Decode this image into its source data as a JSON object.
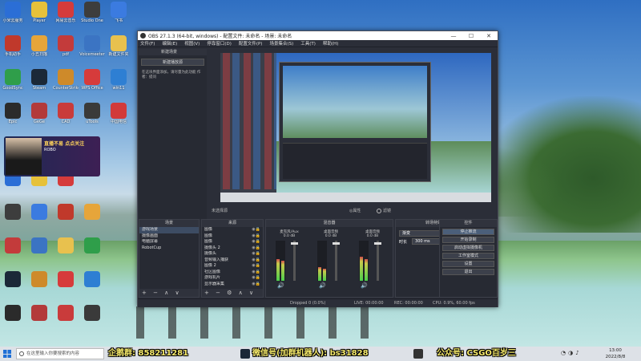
{
  "window": {
    "title": "OBS 27.1.3 (64-bit, windows) - 配置文件: 未命名 - 场景: 未命名",
    "controls": [
      "—",
      "☐",
      "✕"
    ]
  },
  "menu": [
    "文件(F)",
    "编辑(E)",
    "视图(V)",
    "停靠窗口(D)",
    "配置文件(P)",
    "场景集合(S)",
    "工具(T)",
    "帮助(H)"
  ],
  "left_panel": {
    "header": "新建场景",
    "button": "新建播放源",
    "note": "在这块界面添加，请尽量为此功能\n作者：提问"
  },
  "scene_bar": {
    "left": "未选择源",
    "mid": "◎属性",
    "right": "滤镜"
  },
  "docks": {
    "scenes": {
      "title": "场景",
      "items": [
        "游戏场景",
        "摄像画面",
        "电脑屏幕",
        "RobotCup"
      ],
      "selected": 0
    },
    "sources": {
      "title": "来源",
      "items": [
        "图像",
        "图像",
        "图像",
        "摄像头 2",
        "摄像头",
        "音频输入捕获",
        "图像 2",
        "社区图像",
        "游戏机片",
        "显示器采集"
      ]
    },
    "mixer": {
      "title": "混音器",
      "channels": [
        {
          "name": "麦克风/Aux",
          "db": "0.0 dB"
        },
        {
          "name": "桌面音频",
          "db": "0.0 dB"
        },
        {
          "name": "桌面音频",
          "db": "0.0 dB"
        }
      ]
    },
    "transitions": {
      "title": "转场特效",
      "selected": "渐变",
      "duration_label": "时长",
      "duration": "300 ms"
    },
    "controls": {
      "title": "控件",
      "buttons": [
        "停止推流",
        "开始录制",
        "启动虚拟摄像机",
        "工作室模式",
        "设置",
        "退出"
      ]
    }
  },
  "status": {
    "live": "LIVE: 00:00:00",
    "rec": "REC: 00:00:00",
    "cpu": "CPU: 0.9%, 60.00 fps",
    "dropped": "Dropped 0 (0.0%)"
  },
  "desktop_icons": [
    {
      "label": "小米云服务",
      "color": "#2b6ed6"
    },
    {
      "label": "Player",
      "color": "#e6c13a"
    },
    {
      "label": "网易云音乐",
      "color": "#d53b3b"
    },
    {
      "label": "Studio One",
      "color": "#3d3d3d"
    },
    {
      "label": "飞书",
      "color": "#3b7be0"
    },
    {
      "label": "手机助手",
      "color": "#c0392b"
    },
    {
      "label": "小丑扫描",
      "color": "#e6a53a"
    },
    {
      "label": "pdf",
      "color": "#c33b3b"
    },
    {
      "label": "Voicemeeter",
      "color": "#3b74c3"
    },
    {
      "label": "新建文件夹",
      "color": "#e8c14e"
    },
    {
      "label": "GoodSync",
      "color": "#2f9e4a"
    },
    {
      "label": "Steam",
      "color": "#1b2838"
    },
    {
      "label": "CounterStrike",
      "color": "#ce8a2a"
    },
    {
      "label": "WPS Office",
      "color": "#d63b3b"
    },
    {
      "label": "win11",
      "color": "#2e7fd3"
    },
    {
      "label": "Epic",
      "color": "#2b2b2b"
    },
    {
      "label": "GeGe",
      "color": "#b33a3a"
    },
    {
      "label": "CAD",
      "color": "#c93b3b"
    },
    {
      "label": "uTools",
      "color": "#3a3a3a"
    },
    {
      "label": "中国电信",
      "color": "#d23a3a"
    }
  ],
  "ad": {
    "line1": "直播不易 点点关注",
    "line2": "ROBO"
  },
  "taskbar": {
    "search_placeholder": "在这里输入你要搜索的内容",
    "watermark_qq": "企鹅群: 858211281",
    "watermark_wx": "微信号(加群机器人): bs31828",
    "watermark_gzh": "公众号: CSGO百岁三",
    "time": "13:00",
    "date": "2022/8/8"
  }
}
